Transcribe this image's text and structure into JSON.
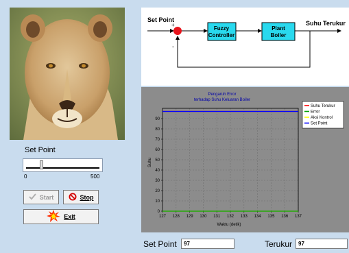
{
  "diagram": {
    "input_label": "Set Point",
    "plus_sign": "+",
    "minus_sign": "-",
    "controller_line1": "Fuzzy",
    "controller_line2": "Controller",
    "plant_line1": "Plant",
    "plant_line2": "Boiler",
    "output_label": "Suhu Terukur",
    "colors": {
      "block_fill": "#29d9ee",
      "sum_junction": "#e8141c"
    }
  },
  "controls": {
    "setpoint_label": "Set Point",
    "slider": {
      "min_label": "0",
      "max_label": "500",
      "min": 0,
      "max": 500,
      "value": 97
    },
    "start_button": {
      "label": "Start",
      "underline_char": "S",
      "enabled": false,
      "icon": "check-icon"
    },
    "stop_button": {
      "label": "Stop",
      "underline_char": "S",
      "enabled": true,
      "icon": "no-entry-icon"
    },
    "exit_button": {
      "label": "Exit",
      "underline_char": "E",
      "enabled": true,
      "icon": "explosion-icon"
    }
  },
  "readouts": {
    "setpoint_label": "Set Point",
    "setpoint_value": "97",
    "terukur_label": "Terukur",
    "terukur_value": "97"
  },
  "chart_data": {
    "type": "line",
    "title_line1": "Pengaruh Error",
    "title_line2": "terhadap Suhu Keluaran Boiler",
    "xlabel": "Waktu (detik)",
    "ylabel": "Suhu",
    "xlim": [
      127,
      137
    ],
    "ylim": [
      0,
      100
    ],
    "xticks": [
      127,
      128,
      129,
      130,
      131,
      132,
      133,
      134,
      135,
      136,
      137
    ],
    "yticks": [
      0,
      10,
      20,
      30,
      40,
      50,
      60,
      70,
      80,
      90
    ],
    "grid": true,
    "background": "#8c8c8c",
    "legend_position": "top-right",
    "legend": [
      {
        "name": "Suhu Terukur",
        "color": "#ff0000"
      },
      {
        "name": "Error",
        "color": "#00a000"
      },
      {
        "name": "Aksi Kontrol",
        "color": "#ffff00"
      },
      {
        "name": "Set Point",
        "color": "#0000ff"
      }
    ],
    "series": [
      {
        "name": "Set Point",
        "color": "#0000ff",
        "x": [
          127,
          137
        ],
        "values": [
          97,
          97
        ]
      },
      {
        "name": "Suhu Terukur",
        "color": "#ff0000",
        "x": [
          127,
          137
        ],
        "values": [
          97,
          97
        ]
      },
      {
        "name": "Error",
        "color": "#00a000",
        "x": [
          127,
          137
        ],
        "values": [
          0,
          0
        ]
      },
      {
        "name": "Aksi Kontrol",
        "color": "#ffff00",
        "x": [
          127,
          137
        ],
        "values": [
          0,
          0
        ]
      }
    ]
  }
}
